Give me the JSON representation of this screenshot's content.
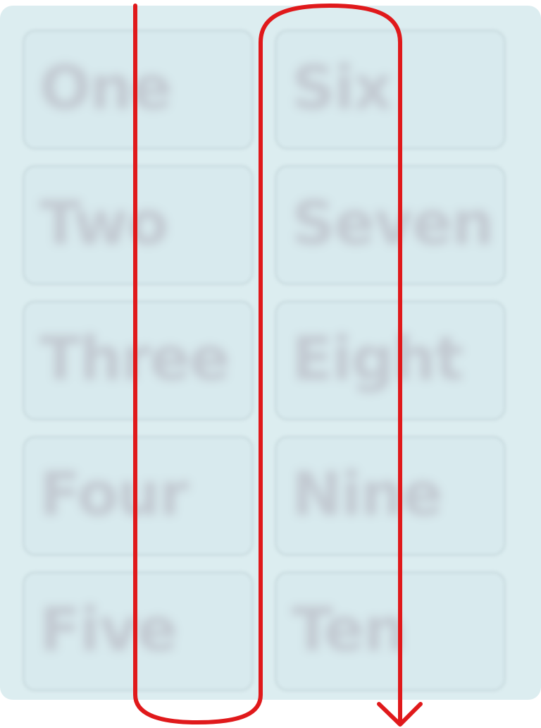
{
  "cells": [
    {
      "label": "One"
    },
    {
      "label": "Two"
    },
    {
      "label": "Three"
    },
    {
      "label": "Four"
    },
    {
      "label": "Five"
    },
    {
      "label": "Six"
    },
    {
      "label": "Seven"
    },
    {
      "label": "Eight"
    },
    {
      "label": "Nine"
    },
    {
      "label": "Ten"
    }
  ],
  "colors": {
    "panel_background": "#dcedf0",
    "cell_text": "#c2c9d1",
    "reading_path": "#e0191b"
  },
  "reading_order": "column-major: down the left column, then down the right column"
}
